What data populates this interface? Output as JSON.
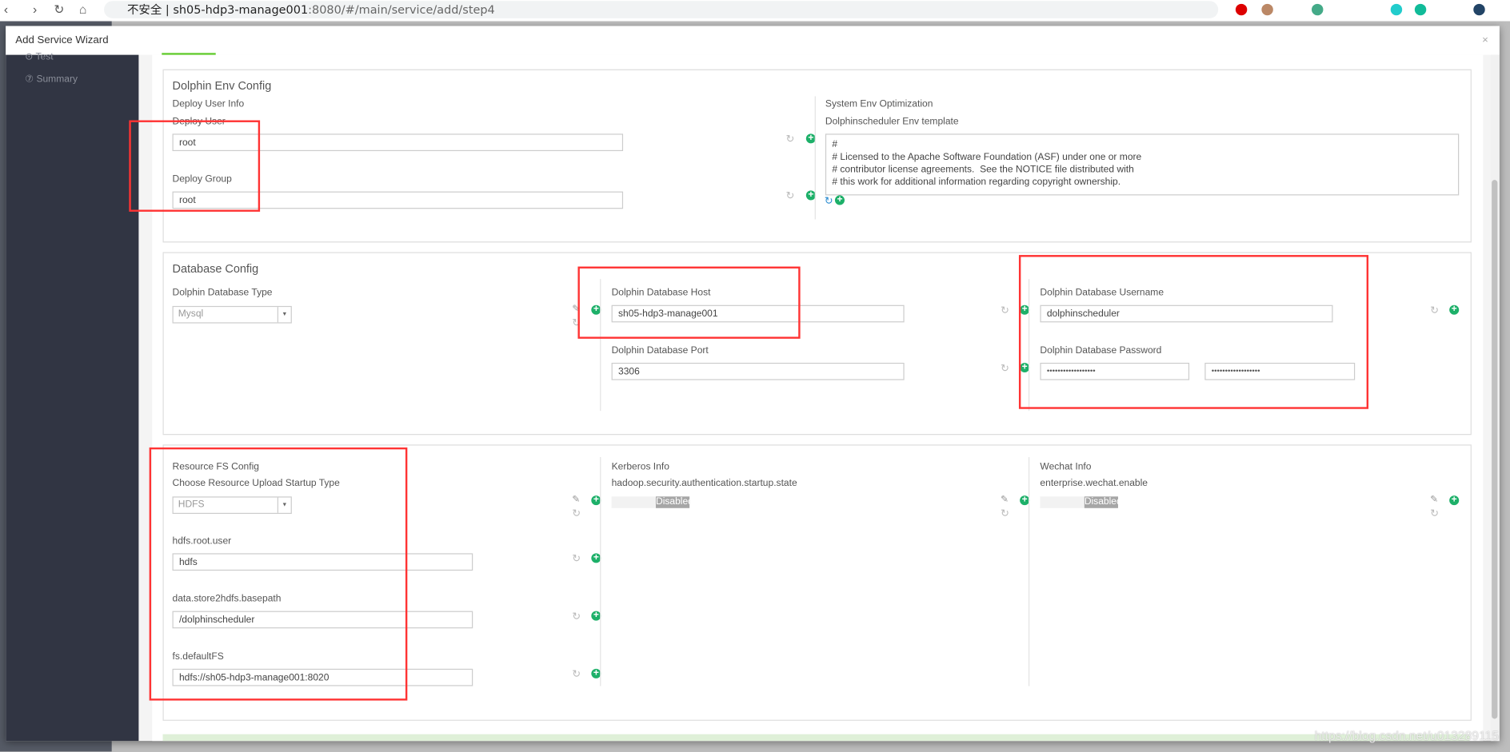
{
  "browser": {
    "url_prefix": "不安全 | ",
    "url_host": "sh05-hdp3-manage001",
    "url_rest": ":8080/#/main/service/add/step4"
  },
  "modal": {
    "title": "Add Service Wizard",
    "close": "×"
  },
  "sidebar": {
    "items": [
      {
        "label": "Test"
      },
      {
        "label": "Summary"
      }
    ]
  },
  "env": {
    "title": "Dolphin Env Config",
    "user_info": "Deploy User Info",
    "deploy_user_label": "Deploy User",
    "deploy_user": "root",
    "deploy_group_label": "Deploy Group",
    "deploy_group": "root",
    "sys_opt": "System Env Optimization",
    "template_label": "Dolphinscheduler Env template",
    "template": "#\n# Licensed to the Apache Software Foundation (ASF) under one or more\n# contributor license agreements.  See the NOTICE file distributed with\n# this work for additional information regarding copyright ownership."
  },
  "db": {
    "title": "Database Config",
    "type_label": "Dolphin Database Type",
    "type": "Mysql",
    "host_label": "Dolphin Database Host",
    "host": "sh05-hdp3-manage001",
    "port_label": "Dolphin Database Port",
    "port": "3306",
    "user_label": "Dolphin Database Username",
    "user": "dolphinscheduler",
    "pass_label": "Dolphin Database Password",
    "pass": "••••••••••••••••••",
    "pass_confirm": "••••••••••••••••••"
  },
  "fs": {
    "title": "Resource FS Config",
    "type_label": "Choose Resource Upload Startup Type",
    "type": "HDFS",
    "root_user_label": "hdfs.root.user",
    "root_user": "hdfs",
    "basepath_label": "data.store2hdfs.basepath",
    "basepath": "/dolphinscheduler",
    "defaultfs_label": "fs.defaultFS",
    "defaultfs": "hdfs://sh05-hdp3-manage001:8020"
  },
  "kerberos": {
    "title": "Kerberos Info",
    "label": "hadoop.security.authentication.startup.state",
    "state": "Disabled"
  },
  "wechat": {
    "title": "Wechat Info",
    "label": "enterprise.wechat.enable",
    "state": "Disabled"
  },
  "watermark": "https://blog.csdn.net/u013289115",
  "colors": {
    "accent": "#1db069",
    "highlight": "#ff3333",
    "sidebar": "#313543"
  }
}
